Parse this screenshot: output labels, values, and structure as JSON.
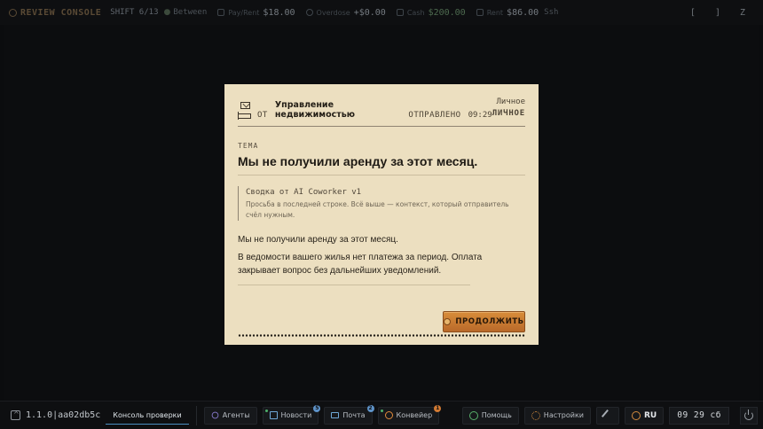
{
  "topbar": {
    "brand": "REVIEW CONSOLE",
    "shift": "SHIFT 6/13",
    "phase": "Between",
    "stats": [
      {
        "label": "Pay/Rent",
        "value": "$18.00"
      },
      {
        "label": "Overdose",
        "value": "+$0.00"
      },
      {
        "label": "Cash",
        "value": "$200.00"
      },
      {
        "label": "Rent",
        "value": "$86.00",
        "unit": "Ssh"
      }
    ],
    "right_keys": [
      "[",
      "]",
      "Z"
    ]
  },
  "letter": {
    "from_label": "ОТ",
    "sender": "Управление недвижимостью",
    "sent_label": "ОТПРАВЛЕНО",
    "sent_time": "09:29",
    "category_top": "Личное",
    "category_caps": "ЛИЧНОЕ",
    "subject_label": "ТЕМА",
    "subject": "Мы не получили аренду за этот месяц.",
    "summary_title": "Сводка от AI Coworker v1",
    "summary_desc": "Просьба в последней строке. Всё выше — контекст, который отправитель счёл нужным.",
    "body_1": "Мы не получили аренду за этот месяц.",
    "body_2": "В ведомости вашего жилья нет платежа за период. Оплата закрывает вопрос без дальнейших уведомлений.",
    "continue_label": "ПРОДОЛЖИТЬ"
  },
  "taskbar": {
    "version": "1.1.0|aa02db5c",
    "active_tab": "Консоль проверки",
    "agents": "Агенты",
    "news": "Новости",
    "news_badge": "5",
    "mail": "Почта",
    "mail_badge": "2",
    "conveyor": "Конвейер",
    "conveyor_badge": "1",
    "help": "Помощь",
    "settings": "Настройки",
    "lang": "RU",
    "clock": "09 29 сб"
  },
  "colors": {
    "letter_bg": "#ecdfc0",
    "accent_orange": "#c9772f",
    "tab_underline": "#4a8fc0"
  }
}
